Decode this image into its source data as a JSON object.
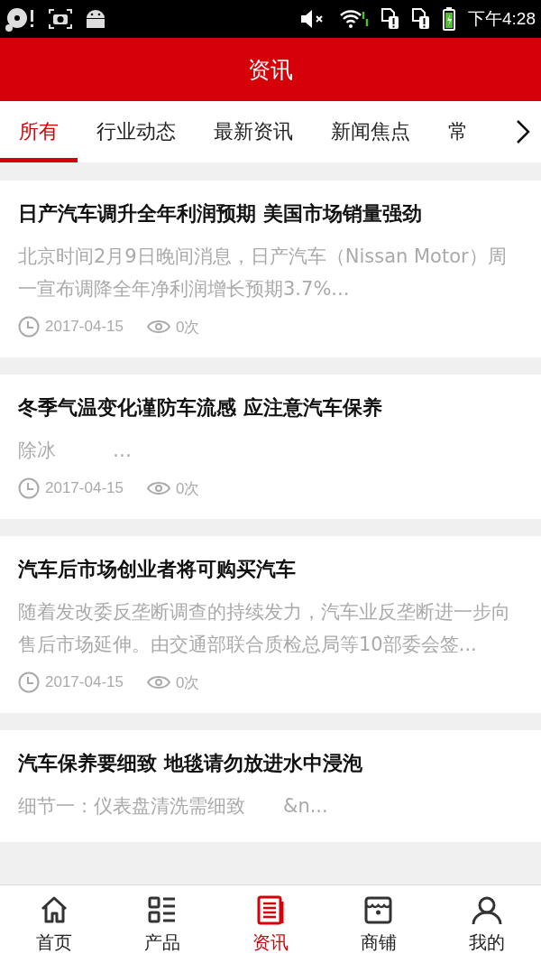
{
  "status_bar": {
    "time": "下午4:28"
  },
  "header": {
    "title": "资讯"
  },
  "tabs": [
    {
      "label": "所有",
      "selected": true
    },
    {
      "label": "行业动态",
      "selected": false
    },
    {
      "label": "最新资讯",
      "selected": false
    },
    {
      "label": "新闻焦点",
      "selected": false
    },
    {
      "label": "常",
      "selected": false
    }
  ],
  "articles": [
    {
      "title": "日产汽车调升全年利润预期 美国市场销量强劲",
      "summary": "北京时间2月9日晚间消息，日产汽车（Nissan Motor）周一宣布调降全年净利润增长预期3.7%...",
      "date": "2017-04-15",
      "views": "0次"
    },
    {
      "title": "冬季气温变化谨防车流感 应注意汽车保养",
      "summary": "除冰　　　…",
      "date": "2017-04-15",
      "views": "0次"
    },
    {
      "title": "汽车后市场创业者将可购买汽车",
      "summary": "随着发改委反垄断调查的持续发力，汽车业反垄断进一步向售后市场延伸。由交通部联合质检总局等10部委会签...",
      "date": "2017-04-15",
      "views": "0次"
    },
    {
      "title": "汽车保养要细致 地毯请勿放进水中浸泡",
      "summary": "细节一：仪表盘清洗需细致　　&n..."
    }
  ],
  "bottom_nav": [
    {
      "label": "首页",
      "kind": "home",
      "selected": false
    },
    {
      "label": "产品",
      "kind": "list",
      "selected": false
    },
    {
      "label": "资讯",
      "kind": "news",
      "selected": true
    },
    {
      "label": "商铺",
      "kind": "shop",
      "selected": false
    },
    {
      "label": "我的",
      "kind": "user",
      "selected": false
    }
  ]
}
